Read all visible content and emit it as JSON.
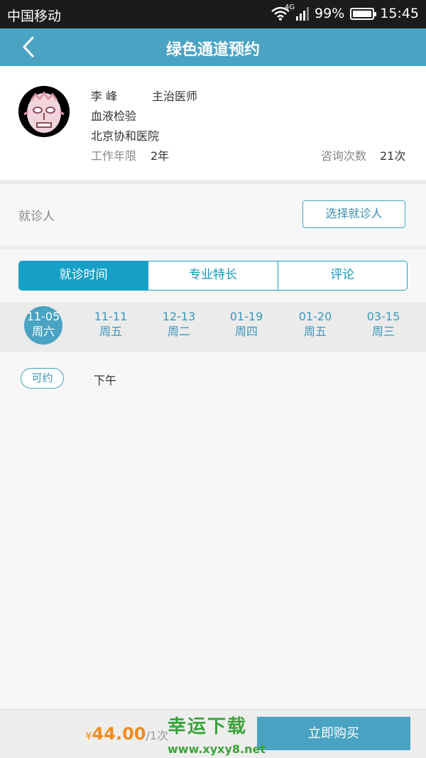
{
  "status_bar": {
    "carrier": "中国移动",
    "network": "4G",
    "battery": "99%",
    "time": "15:45"
  },
  "nav": {
    "title": "绿色通道预约"
  },
  "doctor": {
    "name": "李 峰",
    "title": "主治医师",
    "department": "血液检验",
    "hospital": "北京协和医院",
    "years_label": "工作年限",
    "years_value": "2年",
    "consult_label": "咨询次数",
    "consult_value": "21次"
  },
  "patient": {
    "label": "就诊人",
    "select_button": "选择就诊人"
  },
  "tabs": [
    {
      "label": "就诊时间",
      "active": true
    },
    {
      "label": "专业特长",
      "active": false
    },
    {
      "label": "评论",
      "active": false
    }
  ],
  "dates": [
    {
      "date": "11-05",
      "weekday": "周六",
      "selected": true
    },
    {
      "date": "11-11",
      "weekday": "周五",
      "selected": false
    },
    {
      "date": "12-13",
      "weekday": "周二",
      "selected": false
    },
    {
      "date": "01-19",
      "weekday": "周四",
      "selected": false
    },
    {
      "date": "01-20",
      "weekday": "周五",
      "selected": false
    },
    {
      "date": "03-15",
      "weekday": "周三",
      "selected": false
    }
  ],
  "slots": [
    {
      "status": "可约",
      "period": "下午"
    }
  ],
  "footer": {
    "currency": "¥",
    "price": "44.00",
    "unit": "/1次",
    "buy_button": "立即购买"
  },
  "watermark": {
    "title": "幸运下载",
    "url": "www.xyxy8.net"
  },
  "colors": {
    "accent": "#4aa3c2",
    "tab_active": "#16a0c6",
    "price": "#f08c1e",
    "watermark": "#3aa33a"
  }
}
